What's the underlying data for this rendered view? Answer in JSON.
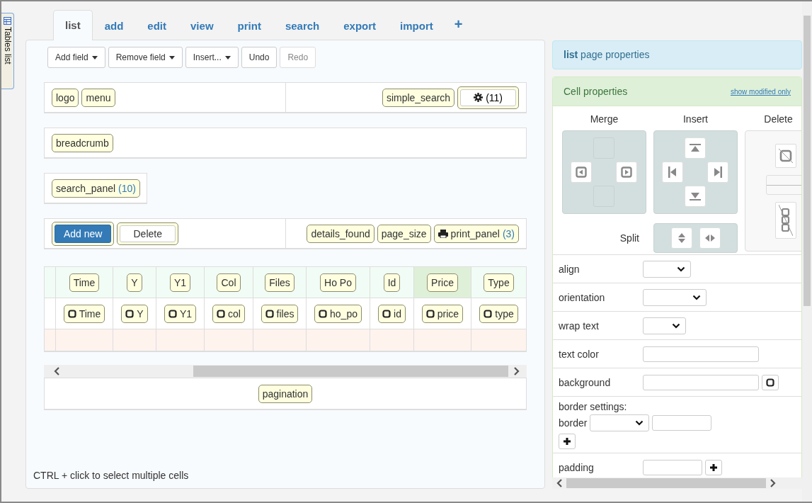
{
  "side_tab": {
    "label": "Tables list"
  },
  "tabs": [
    {
      "label": "list",
      "selected": true
    },
    {
      "label": "add",
      "selected": false
    },
    {
      "label": "edit",
      "selected": false
    },
    {
      "label": "view",
      "selected": false
    },
    {
      "label": "print",
      "selected": false
    },
    {
      "label": "search",
      "selected": false
    },
    {
      "label": "export",
      "selected": false
    },
    {
      "label": "import",
      "selected": false
    },
    {
      "label": "+",
      "selected": false
    }
  ],
  "toolbar": [
    {
      "label": "Add field",
      "dropdown": true,
      "disabled": false
    },
    {
      "label": "Remove field",
      "dropdown": true,
      "disabled": false
    },
    {
      "label": "Insert...",
      "dropdown": true,
      "disabled": false
    },
    {
      "label": "Undo",
      "dropdown": false,
      "disabled": false
    },
    {
      "label": "Redo",
      "dropdown": false,
      "disabled": true
    }
  ],
  "layout_rows": [
    {
      "kind": "split",
      "cells": [
        {
          "items": [
            {
              "kind": "chip",
              "label": "logo"
            },
            {
              "kind": "chip",
              "label": "menu"
            }
          ]
        },
        {
          "items": [
            {
              "kind": "chip",
              "label": "simple_search"
            },
            {
              "kind": "gear",
              "label": "(11)"
            }
          ]
        }
      ]
    },
    {
      "kind": "full",
      "cells": [
        {
          "items": [
            {
              "kind": "chip",
              "label": "breadcrumb"
            }
          ]
        }
      ]
    },
    {
      "kind": "compact",
      "cells": [
        {
          "items": [
            {
              "kind": "chip",
              "label": "search_panel",
              "count": "(10)"
            }
          ]
        }
      ]
    },
    {
      "kind": "split",
      "cells": [
        {
          "items": [
            {
              "kind": "primary",
              "label": "Add new"
            },
            {
              "kind": "plain",
              "label": "Delete"
            }
          ]
        },
        {
          "items": [
            {
              "kind": "chip",
              "label": "details_found"
            },
            {
              "kind": "chip",
              "label": "page_size"
            },
            {
              "kind": "printer",
              "label": "print_panel",
              "count": "(3)"
            }
          ]
        }
      ]
    }
  ],
  "grid": {
    "columns": [
      {
        "header": "Time",
        "field": "Time",
        "selected": false
      },
      {
        "header": "Y",
        "field": "Y",
        "selected": false
      },
      {
        "header": "Y1",
        "field": "Y1",
        "selected": false
      },
      {
        "header": "Col",
        "field": "col",
        "selected": false
      },
      {
        "header": "Files",
        "field": "files",
        "selected": false
      },
      {
        "header": "Ho Po",
        "field": "ho_po",
        "selected": false
      },
      {
        "header": "Id",
        "field": "id",
        "selected": false
      },
      {
        "header": "Price",
        "field": "price",
        "selected": true
      },
      {
        "header": "Type",
        "field": "type",
        "selected": false
      }
    ]
  },
  "pagination": {
    "label": "pagination"
  },
  "hint": "CTRL + click to select multiple cells",
  "page_properties": {
    "title": "**list** page properties"
  },
  "cell_properties": {
    "title": "Cell properties",
    "link": "show modified only",
    "merge": "Merge",
    "insert": "Insert",
    "delete": "Delete",
    "split": "Split",
    "properties": [
      {
        "kind": "select",
        "label": "align"
      },
      {
        "kind": "select",
        "label": "orientation"
      },
      {
        "kind": "select",
        "label": "wrap text"
      },
      {
        "kind": "text",
        "label": "text color"
      },
      {
        "kind": "color",
        "label": "background"
      },
      {
        "kind": "border",
        "label": "border settings:",
        "sublabel": "border"
      },
      {
        "kind": "padding",
        "label": "padding"
      }
    ]
  }
}
